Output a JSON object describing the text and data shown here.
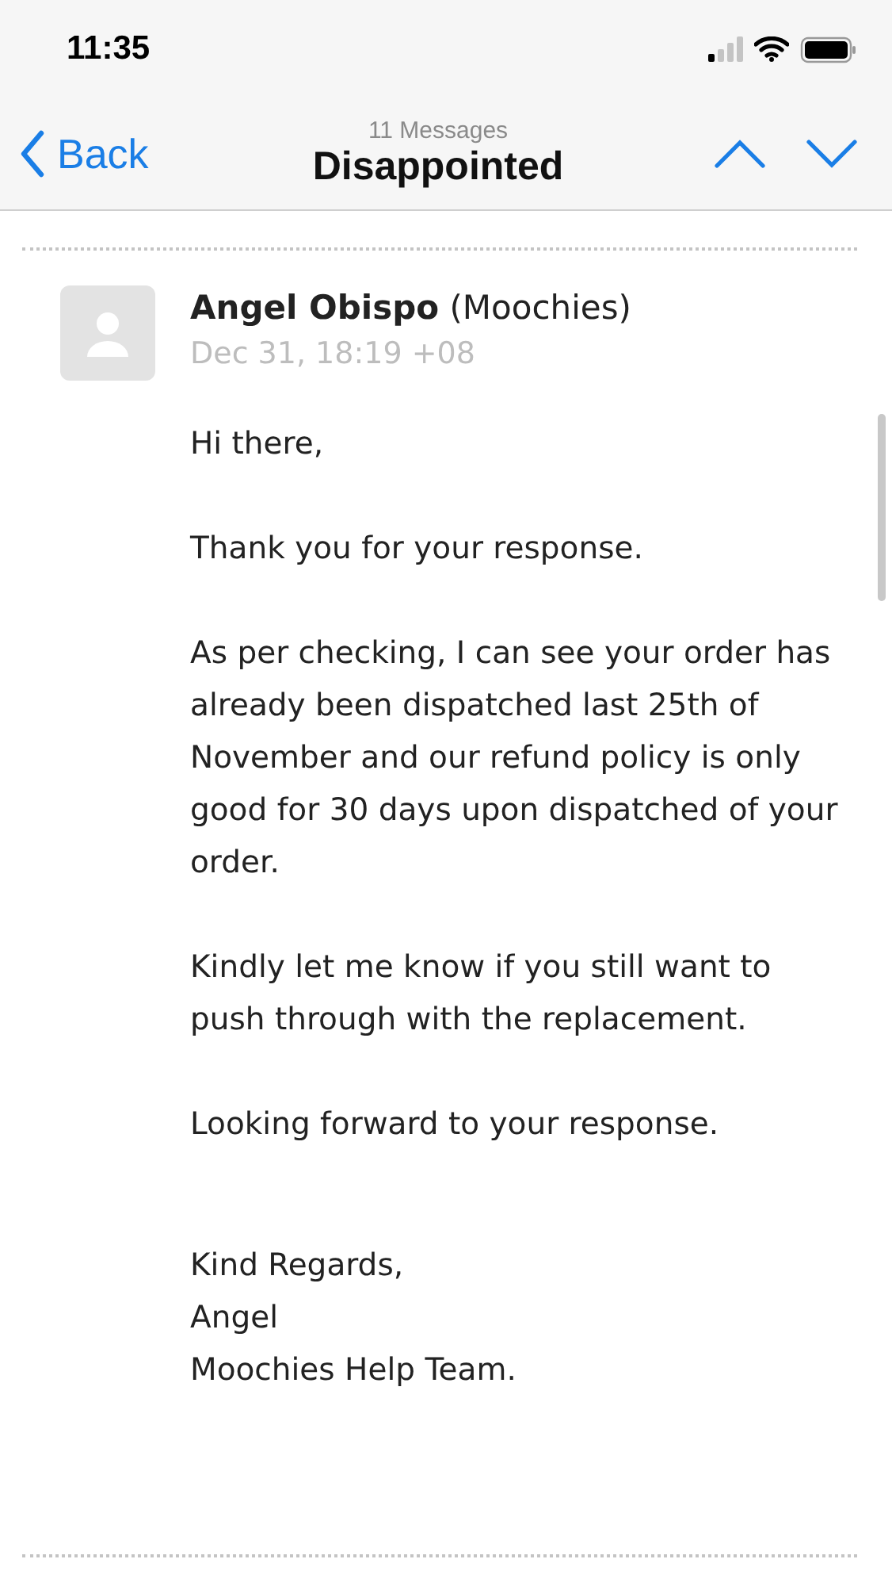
{
  "status_bar": {
    "time": "11:35"
  },
  "nav": {
    "back": "Back",
    "subtitle": "11 Messages",
    "title": "Disappointed"
  },
  "message": {
    "sender": "Angel Obispo",
    "organization": "(Moochies)",
    "date": "Dec 31, 18:19 +08",
    "paragraphs": [
      "Hi there,",
      "Thank you for your response.",
      "As per checking, I can see your order has already been dispatched last 25th of November and our refund policy is only good for 30 days upon dispatched of your order.",
      "Kindly let me know if you still want to push through with the replacement.",
      "Looking forward to your response."
    ],
    "signature": [
      "Kind Regards,",
      "Angel",
      "Moochies Help Team."
    ]
  }
}
